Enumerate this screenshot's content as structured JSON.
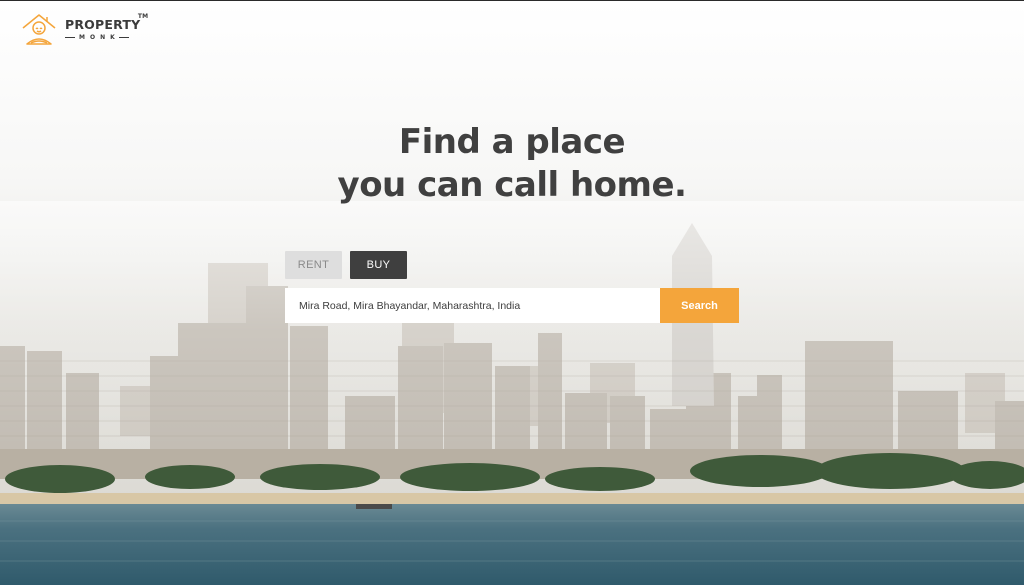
{
  "brand": {
    "name": "PROPERTY",
    "trademark": "TM",
    "sub": "MONK",
    "accent_color": "#f4a53b"
  },
  "hero": {
    "title_line1": "Find a place",
    "title_line2": "you can call home."
  },
  "search": {
    "tabs": [
      {
        "label": "RENT",
        "active": false
      },
      {
        "label": "BUY",
        "active": true
      }
    ],
    "value": "Mira Road, Mira Bhayandar, Maharashtra, India",
    "button_label": "Search",
    "button_color": "#f4a53b"
  },
  "icons": {
    "logo": "house-monk-icon"
  }
}
